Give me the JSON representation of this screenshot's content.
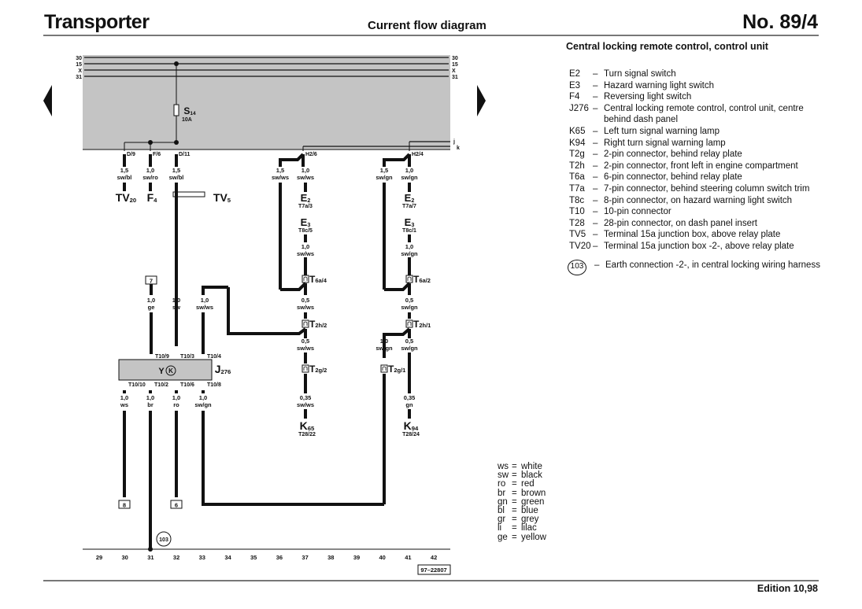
{
  "header": {
    "title": "Transporter",
    "subtitle": "Current flow diagram",
    "number": "No. 89/4"
  },
  "footer": {
    "edition": "Edition 10,98"
  },
  "legend": {
    "title": "Central locking remote control, control unit",
    "items": [
      {
        "code": "E2",
        "desc": "Turn signal switch"
      },
      {
        "code": "E3",
        "desc": "Hazard warning light switch"
      },
      {
        "code": "F4",
        "desc": "Reversing light switch"
      },
      {
        "code": "J276",
        "desc": "Central locking remote control, control unit, centre behind dash panel"
      },
      {
        "code": "K65",
        "desc": "Left turn signal warning lamp"
      },
      {
        "code": "K94",
        "desc": "Right turn signal warning lamp"
      },
      {
        "code": "T2g",
        "desc": "2-pin connector, behind relay plate"
      },
      {
        "code": "T2h",
        "desc": "2-pin connector, front left in engine compartment"
      },
      {
        "code": "T6a",
        "desc": "6-pin connector, behind relay plate"
      },
      {
        "code": "T7a",
        "desc": "7-pin connector, behind steering column switch trim"
      },
      {
        "code": "T8c",
        "desc": "8-pin connector, on hazard warning light switch"
      },
      {
        "code": "T10",
        "desc": "10-pin connector"
      },
      {
        "code": "T28",
        "desc": "28-pin connector, on dash panel insert"
      },
      {
        "code": "TV5",
        "desc": "Terminal 15a junction box, above relay plate"
      },
      {
        "code": "TV20",
        "desc": "Terminal 15a junction box -2-, above relay plate"
      }
    ],
    "earth": {
      "code": "103",
      "desc": "Earth connection -2-, in central locking wiring harness"
    }
  },
  "color_codes": [
    {
      "abbr": "ws",
      "name": "white"
    },
    {
      "abbr": "sw",
      "name": "black"
    },
    {
      "abbr": "ro",
      "name": "red"
    },
    {
      "abbr": "br",
      "name": "brown"
    },
    {
      "abbr": "gn",
      "name": "green"
    },
    {
      "abbr": "bl",
      "name": "blue"
    },
    {
      "abbr": "gr",
      "name": "grey"
    },
    {
      "abbr": "li",
      "name": "lilac"
    },
    {
      "abbr": "ge",
      "name": "yellow"
    }
  ],
  "diagram": {
    "bus_labels": [
      "30",
      "15",
      "X",
      "31"
    ],
    "bus_right_labels_bottom": [
      "j",
      "k"
    ],
    "fuse": {
      "name": "S",
      "sub": "14",
      "rating": "10A"
    },
    "relay_terminals": [
      "D/9",
      "F/6",
      "D/11",
      "H2/6",
      "H2/4"
    ],
    "wires_top": [
      {
        "size": "1,5",
        "color": "sw/bl"
      },
      {
        "size": "1,0",
        "color": "sw/ro"
      },
      {
        "size": "1,5",
        "color": "sw/bl"
      },
      {
        "size": "1,5",
        "color": "sw/ws"
      },
      {
        "size": "1,0",
        "color": "sw/ws"
      },
      {
        "size": "1,5",
        "color": "sw/gn"
      },
      {
        "size": "1,0",
        "color": "sw/gn"
      }
    ],
    "components_top": [
      {
        "name": "TV",
        "sub": "20"
      },
      {
        "name": "F",
        "sub": "4"
      },
      {
        "name": "TV",
        "sub": "5"
      }
    ],
    "left_switch": {
      "e2": {
        "name": "E",
        "sub": "2",
        "pin": "T7a/3"
      },
      "e3": {
        "name": "E",
        "sub": "3",
        "pin": "T8c/5"
      },
      "wire": {
        "size": "1,0",
        "color": "sw/ws"
      },
      "t6a": "6a/4",
      "wire2": {
        "size": "0,5",
        "color": "sw/ws"
      },
      "t2h": "2h/2",
      "wire3": {
        "size": "0,5",
        "color": "sw/ws"
      },
      "t2g": "2g/2",
      "wire4": {
        "size": "0,35",
        "color": "sw/ws"
      },
      "lamp": {
        "name": "K",
        "sub": "65",
        "pin": "T28/22"
      }
    },
    "right_switch": {
      "e2": {
        "name": "E",
        "sub": "2",
        "pin": "T7a/7"
      },
      "e3": {
        "name": "E",
        "sub": "3",
        "pin": "T8c/1"
      },
      "wire": {
        "size": "1,0",
        "color": "sw/gn"
      },
      "t6a": "6a/2",
      "wire2": {
        "size": "0,5",
        "color": "sw/gn"
      },
      "t2h": "2h/1",
      "wire3": {
        "size": "0,5",
        "color": "sw/gn"
      },
      "wire3b": {
        "size": "1,0",
        "color": "sw/gn"
      },
      "t2g": "2g/1",
      "wire4": {
        "size": "0,35",
        "color": "gn"
      },
      "lamp": {
        "name": "K",
        "sub": "94",
        "pin": "T28/24"
      }
    },
    "ref_box_7": "7",
    "control_unit": {
      "name": "J",
      "sub": "276",
      "pins_top": [
        "T10/9",
        "T10/3",
        "T10/4"
      ],
      "pins_bottom": [
        "T10/10",
        "T10/2",
        "T10/6",
        "T10/8"
      ],
      "wires_top": [
        {
          "size": "1,0",
          "color": "ge"
        },
        {
          "size": "1,0",
          "color": "sw"
        },
        {
          "size": "1,0",
          "color": "sw/ws"
        }
      ],
      "wires_bottom": [
        {
          "size": "1,0",
          "color": "ws"
        },
        {
          "size": "1,0",
          "color": "br"
        },
        {
          "size": "1,0",
          "color": "ro"
        },
        {
          "size": "1,0",
          "color": "sw/gn"
        }
      ]
    },
    "ref_boxes_bottom": [
      "8",
      "6"
    ],
    "earth_label": "103",
    "track_numbers": [
      "29",
      "30",
      "31",
      "32",
      "33",
      "34",
      "35",
      "36",
      "37",
      "38",
      "39",
      "40",
      "41",
      "42"
    ],
    "drawing_number": "97–22807"
  }
}
